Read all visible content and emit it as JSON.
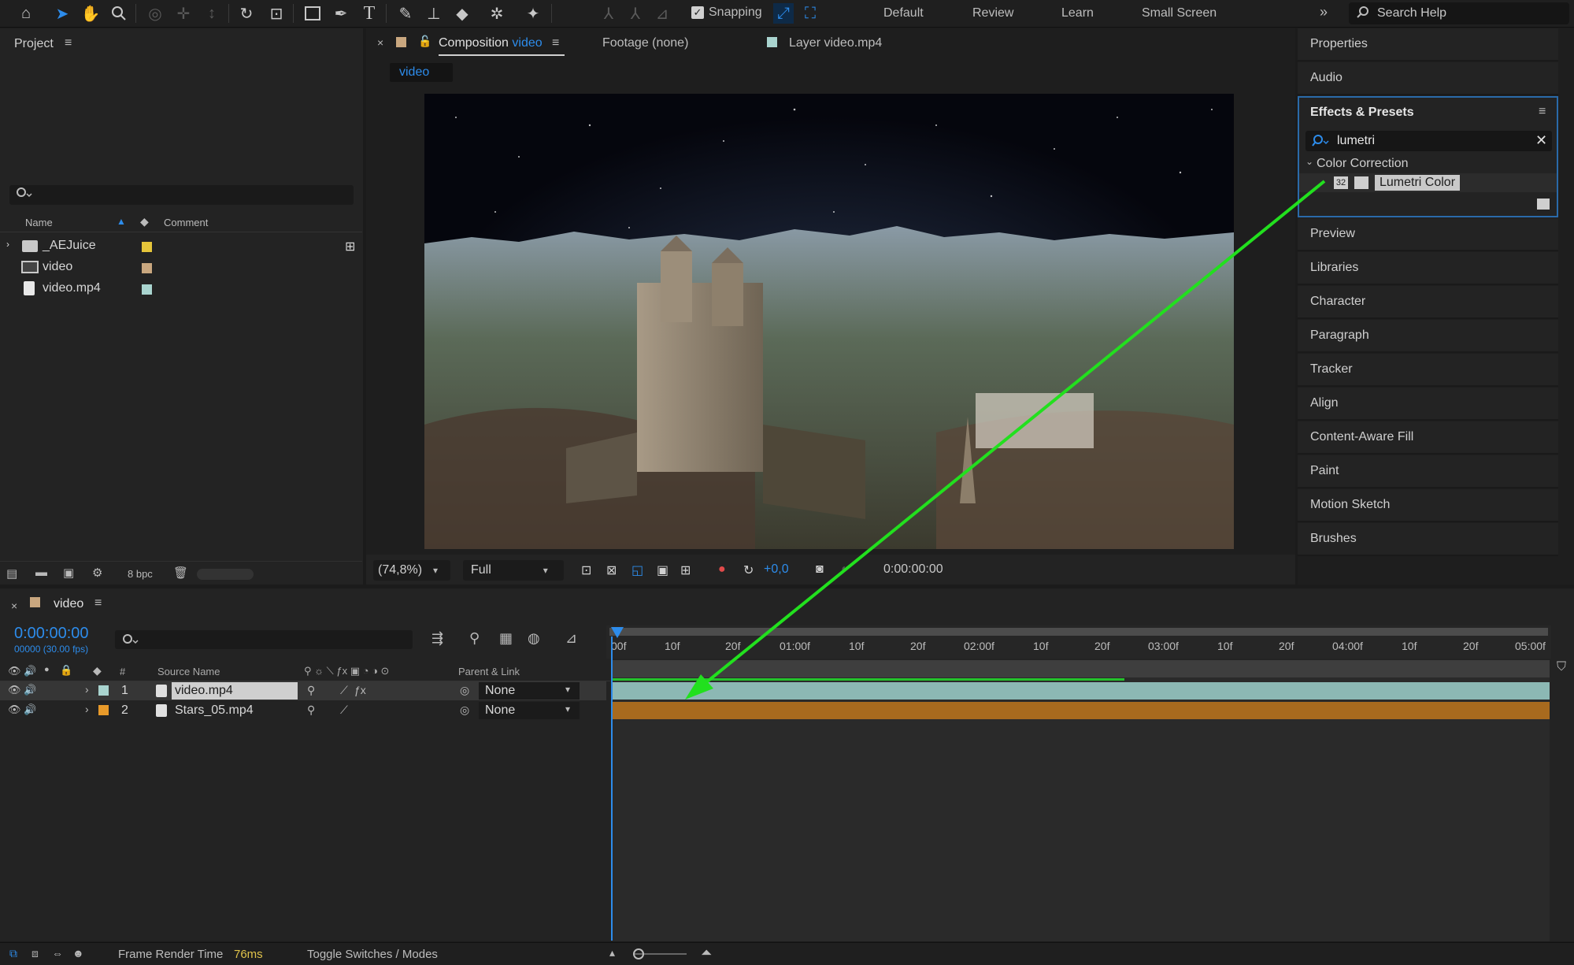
{
  "toolbar": {
    "tools": [
      "home-icon",
      "selection-tool-icon",
      "hand-tool-icon",
      "zoom-tool-icon",
      "orbit-camera-icon",
      "pan-camera-icon",
      "dolly-camera-icon",
      "rotation-tool-icon",
      "pan-behind-icon",
      "rectangle-tool-icon",
      "pen-tool-icon",
      "type-tool-icon",
      "brush-tool-icon",
      "clone-stamp-icon",
      "eraser-tool-icon",
      "roto-brush-icon",
      "puppet-tool-icon"
    ],
    "snapping_label": "Snapping",
    "workspaces": [
      "Default",
      "Review",
      "Learn",
      "Small Screen"
    ],
    "overflow_glyph": "»",
    "search_placeholder": "Search Help"
  },
  "project": {
    "title": "Project",
    "columns": {
      "name": "Name",
      "comment": "Comment"
    },
    "items": [
      {
        "name": "_AEJuice",
        "icon": "folder-icon",
        "color": "#e5c53a"
      },
      {
        "name": "video",
        "icon": "composition-icon",
        "color": "#c9a77f"
      },
      {
        "name": "video.mp4",
        "icon": "footage-file-icon",
        "color": "#a9d4cf"
      }
    ],
    "bpc_label": "8 bpc"
  },
  "comp": {
    "tab_prefix": "Composition",
    "tab_name": "video",
    "footage_tab": "Footage (none)",
    "layer_tab": "Layer video.mp4",
    "breadcrumb": "video",
    "zoom": "(74,8%)",
    "resolution": "Full",
    "exposure": "+0,0",
    "timecode": "0:00:00:00"
  },
  "right_panel": {
    "top_items": [
      "Properties",
      "Audio"
    ],
    "effects": {
      "title": "Effects & Presets",
      "search_value": "lumetri",
      "category": "Color Correction",
      "effect_badge": "32",
      "effect_name": "Lumetri Color"
    },
    "bottom_items": [
      "Preview",
      "Libraries",
      "Character",
      "Paragraph",
      "Tracker",
      "Align",
      "Content-Aware Fill",
      "Paint",
      "Motion Sketch",
      "Brushes"
    ]
  },
  "timeline": {
    "comp_name": "video",
    "timecode": "0:00:00:00",
    "frame_info": "00000 (30.00 fps)",
    "columns": {
      "num": "#",
      "source": "Source Name",
      "parent": "Parent & Link"
    },
    "ruler": [
      "00f",
      "10f",
      "20f",
      "01:00f",
      "10f",
      "20f",
      "02:00f",
      "10f",
      "20f",
      "03:00f",
      "10f",
      "20f",
      "04:00f",
      "10f",
      "20f",
      "05:00f"
    ],
    "layers": [
      {
        "num": "1",
        "name": "video.mp4",
        "color": "#a9d4cf",
        "parent": "None",
        "bar_color": "#8cb8b4"
      },
      {
        "num": "2",
        "name": "Stars_05.mp4",
        "color": "#e89a2a",
        "parent": "None",
        "bar_color": "#a86a1e"
      }
    ]
  },
  "status": {
    "render_label": "Frame Render Time",
    "render_value": "76ms",
    "toggle_label": "Toggle Switches / Modes"
  },
  "colors": {
    "accent": "#2d8ceb",
    "arrow": "#22e01e",
    "panel_focus": "#2a6aa9"
  }
}
